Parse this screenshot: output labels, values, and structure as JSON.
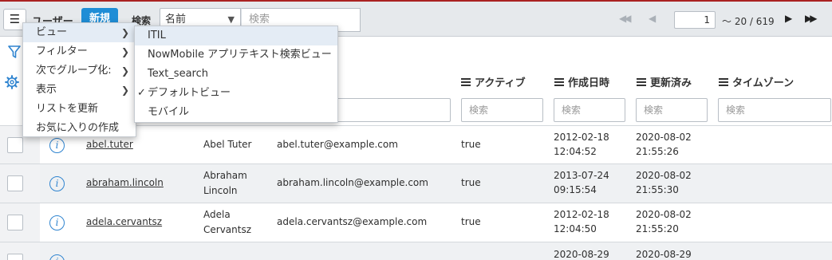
{
  "header": {
    "menu_icon": "hamburger-icon",
    "title": "ユーザー",
    "new_label": "新規",
    "search_label": "検索",
    "search_field": "名前",
    "search_placeholder": "検索",
    "pager": {
      "page": "1",
      "range": "～ 20 / 619"
    }
  },
  "context_menu": {
    "items": [
      {
        "label": "ビュー",
        "has_submenu": true
      },
      {
        "label": "フィルター",
        "has_submenu": true
      },
      {
        "label": "次でグループ化:",
        "has_submenu": true
      },
      {
        "label": "表示",
        "has_submenu": true
      },
      {
        "label": "リストを更新",
        "has_submenu": false
      },
      {
        "label": "お気に入りの作成",
        "has_submenu": false
      }
    ]
  },
  "view_submenu": {
    "items": [
      {
        "label": "ITIL",
        "checked": false
      },
      {
        "label": "NowMobile アプリテキスト検索ビュー",
        "checked": false
      },
      {
        "label": "Text_search",
        "checked": false
      },
      {
        "label": "デフォルトビュー",
        "checked": true
      },
      {
        "label": "モバイル",
        "checked": false
      }
    ]
  },
  "columns": {
    "active": "アクティブ",
    "created": "作成日時",
    "updated": "更新済み",
    "timezone": "タイムゾーン"
  },
  "filter_placeholder": "検索",
  "rows": [
    {
      "user_id": "abel.tuter",
      "name": [
        "Abel Tuter"
      ],
      "email": "abel.tuter@example.com",
      "active": "true",
      "created": [
        "2012-02-18",
        "12:04:52"
      ],
      "updated": [
        "2020-08-02",
        "21:55:26"
      ]
    },
    {
      "user_id": "abraham.lincoln",
      "name": [
        "Abraham",
        "Lincoln"
      ],
      "email": "abraham.lincoln@example.com",
      "active": "true",
      "created": [
        "2013-07-24",
        "09:15:54"
      ],
      "updated": [
        "2020-08-02",
        "21:55:30"
      ]
    },
    {
      "user_id": "adela.cervantsz",
      "name": [
        "Adela",
        "Cervantsz"
      ],
      "email": "adela.cervantsz@example.com",
      "active": "true",
      "created": [
        "2012-02-18",
        "12:04:50"
      ],
      "updated": [
        "2020-08-02",
        "21:55:20"
      ]
    },
    {
      "user_id": "",
      "name": [
        ""
      ],
      "email": "",
      "active": "",
      "created": [
        "2020-08-29",
        ""
      ],
      "updated": [
        "2020-08-29",
        ""
      ]
    }
  ],
  "colors": {
    "accent": "#1f8dd6",
    "menu_highlight": "#e4ecf5",
    "info_icon": "#2f84d0"
  }
}
